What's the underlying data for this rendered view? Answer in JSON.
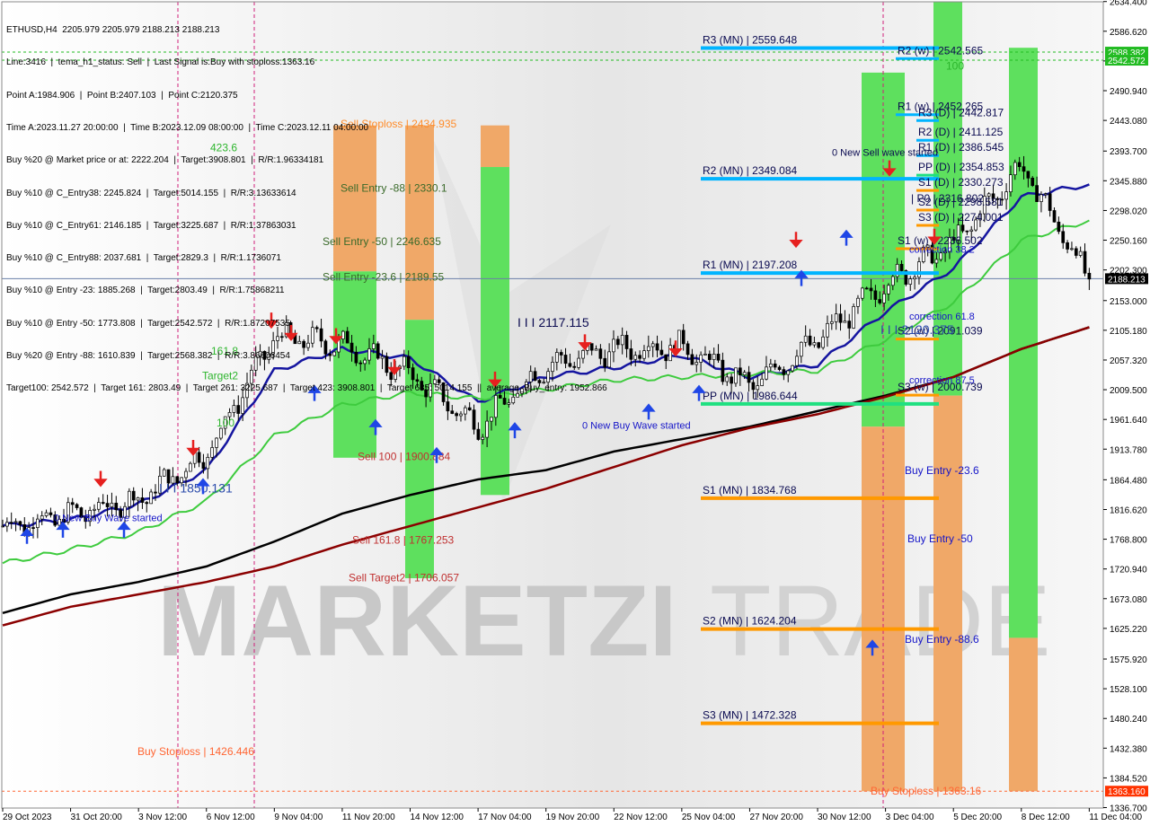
{
  "info_panel": [
    "ETHUSD,H4  2205.979 2205.979 2188.213 2188.213",
    "Line:3416  |  tema_h1_status: Sell  |  Last Signal is:Buy with stoploss:1363.16",
    "Point A:1984.906  |  Point B:2407.103  |  Point C:2120.375",
    "Time A:2023.11.27 20:00:00  |  Time B:2023.12.09 08:00:00  |  Time C:2023.12.11 04:00:00",
    "Buy %20 @ Market price or at: 2222.204  |  Target:3908.801  |  R/R:1.96334181",
    "Buy %10 @ C_Entry38: 2245.824  |  Target:5014.155  |  R/R:3.13633614",
    "Buy %10 @ C_Entry61: 2146.185  |  Target:3225.687  |  R/R:1.37863031",
    "Buy %10 @ C_Entry88: 2037.681  |  Target:2829.3  |  R/R:1.1736071",
    "Buy %10 @ Entry -23: 1885.268  |  Target:2803.49  |  R/R:1.75868211",
    "Buy %10 @ Entry -50: 1773.808  |  Target:2542.572  |  R/R:1.87207535",
    "Buy %20 @ Entry -88: 1610.839  |  Target:2568.382  |  R/R:3.86606454",
    "Target100: 2542.572  |  Target 161: 2803.49  |  Target 261: 3225.687  |  Target 423: 3908.801  |  Target 685: 5014.155  ||  average_Buy_entry: 1952.866"
  ],
  "chart_data": {
    "type": "candlestick",
    "symbol": "ETHUSD",
    "timeframe": "H4",
    "ohlc": {
      "open": 2205.979,
      "high": 2205.979,
      "low": 2188.213,
      "close": 2188.213
    },
    "current_price": 2188.213,
    "ylim": [
      1336.0,
      2634.0
    ],
    "y_ticks": [
      2634.4,
      2586.6,
      2538.8,
      2490.9,
      2443.0,
      2393.7,
      2345.9,
      2298.0,
      2250.2,
      2202.3,
      2153.0,
      2105.2,
      2057.3,
      2009.5,
      1961.6,
      1913.8,
      1864.5,
      1816.6,
      1768.8,
      1720.9,
      1673.1,
      1625.2,
      1575.9,
      1528.1,
      1480.2,
      1432.4,
      1384.5,
      1336.7
    ],
    "y_tick_labels": [
      "2634.400",
      "2586.620",
      "2538.800",
      "2490.940",
      "2443.080",
      "2393.700",
      "2345.880",
      "2298.020",
      "2250.160",
      "2202.300",
      "2153.000",
      "2105.180",
      "2057.320",
      "2009.500",
      "1961.640",
      "1913.780",
      "1864.480",
      "1816.620",
      "1768.800",
      "1720.940",
      "1673.080",
      "1625.220",
      "1575.920",
      "1528.100",
      "1480.240",
      "1432.380",
      "1384.520",
      "1336.700"
    ],
    "x_ticks": [
      "29 Oct 2023",
      "31 Oct 20:00",
      "3 Nov 12:00",
      "6 Nov 12:00",
      "9 Nov 04:00",
      "11 Nov 20:00",
      "14 Nov 12:00",
      "17 Nov 04:00",
      "19 Nov 20:00",
      "22 Nov 12:00",
      "25 Nov 04:00",
      "27 Nov 20:00",
      "30 Nov 12:00",
      "3 Dec 04:00",
      "5 Dec 20:00",
      "8 Dec 12:00",
      "11 Dec 04:00"
    ],
    "price_markers": [
      {
        "label": "2588.382",
        "value": 2553,
        "color": "#22bb22"
      },
      {
        "label": "2542.572",
        "value": 2540,
        "color": "#22bb22"
      },
      {
        "label": "2188.213",
        "value": 2188.213,
        "color": "#000000"
      },
      {
        "label": "1363.160",
        "value": 1363.16,
        "color": "#ff3300"
      }
    ],
    "trend_points": [
      [
        "29 Oct 2023",
        1790
      ],
      [
        "31 Oct 20:00",
        1808
      ],
      [
        "3 Nov 12:00",
        1832
      ],
      [
        "6 Nov 12:00",
        1905
      ],
      [
        "9 Nov 04:00",
        2095
      ],
      [
        "11 Nov 20:00",
        2082
      ],
      [
        "14 Nov 12:00",
        2035
      ],
      [
        "17 Nov 04:00",
        1950
      ],
      [
        "19 Nov 20:00",
        2048
      ],
      [
        "22 Nov 12:00",
        2075
      ],
      [
        "25 Nov 04:00",
        2080
      ],
      [
        "27 Nov 20:00",
        2015
      ],
      [
        "30 Nov 12:00",
        2090
      ],
      [
        "3 Dec 04:00",
        2180
      ],
      [
        "5 Dec 20:00",
        2245
      ],
      [
        "8 Dec 12:00",
        2370
      ],
      [
        "11 Dec 04:00",
        2188
      ]
    ],
    "series": [
      {
        "name": "",
        "color": "#1515a0",
        "values": [
          1790,
          1800,
          1825,
          1880,
          2040,
          2075,
          2060,
          1990,
          2030,
          2045,
          2065,
          2030,
          2050,
          2135,
          2205,
          2320,
          2340
        ]
      },
      {
        "name": "",
        "color": "#3ecb3e",
        "values": [
          1730,
          1752,
          1780,
          1830,
          1935,
          1985,
          2005,
          1995,
          2010,
          2025,
          2030,
          2035,
          2040,
          2090,
          2150,
          2250,
          2282
        ]
      },
      {
        "name": "",
        "color": "#000000",
        "values": [
          1650,
          1680,
          1700,
          1725,
          1765,
          1810,
          1840,
          1865,
          1880,
          1910,
          1930,
          1950,
          1975,
          2000,
          2030,
          2075,
          2110
        ]
      },
      {
        "name": "",
        "color": "#8b0000",
        "values": [
          1630,
          1660,
          1680,
          1700,
          1725,
          1760,
          1790,
          1820,
          1850,
          1885,
          1920,
          1948,
          1970,
          1998,
          2030,
          2075,
          2110
        ]
      }
    ],
    "levels": [
      {
        "label": "R3 (MN) | 2559.648",
        "value": 2559.648,
        "color": "#00b4ff"
      },
      {
        "label": "R2 (MN) | 2349.084",
        "value": 2349.084,
        "color": "#00b4ff"
      },
      {
        "label": "R1 (MN) | 2197.208",
        "value": 2197.208,
        "color": "#00b4ff"
      },
      {
        "label": "PP (MN) | 1986.644",
        "value": 1986.644,
        "color": "#1fe080"
      },
      {
        "label": "S1 (MN) | 1834.768",
        "value": 1834.768,
        "color": "#ff9900"
      },
      {
        "label": "S2 (MN) | 1624.204",
        "value": 1624.204,
        "color": "#ff9900"
      },
      {
        "label": "S3 (MN) | 1472.328",
        "value": 1472.328,
        "color": "#ff9900"
      },
      {
        "label": "R2 (w) | 2542.565",
        "value": 2542.565,
        "color": "#00b4ff"
      },
      {
        "label": "R1 (w) | 2452.265",
        "value": 2452.265,
        "color": "#00b4ff"
      },
      {
        "label": "S1 (w) | 2236.502",
        "value": 2236.502,
        "color": "#ff9900"
      },
      {
        "label": "S2 (w) | 2091.039",
        "value": 2091.039,
        "color": "#ff9900"
      },
      {
        "label": "S3 (w) | 2000.739",
        "value": 2000.739,
        "color": "#ff9900"
      },
      {
        "label": "R3 (D) | 2442.817",
        "value": 2442.817,
        "color": "#00b4ff"
      },
      {
        "label": "R2 (D) | 2411.125",
        "value": 2411.125,
        "color": "#00b4ff"
      },
      {
        "label": "R1 (D) | 2386.545",
        "value": 2386.545,
        "color": "#00b4ff"
      },
      {
        "label": "PP (D) | 2354.853",
        "value": 2354.853,
        "color": "#1fe080"
      },
      {
        "label": "S1 (D) | 2330.273",
        "value": 2330.273,
        "color": "#ff9900"
      },
      {
        "label": "S2 (D) | 2298.581",
        "value": 2298.581,
        "color": "#ff9900"
      },
      {
        "label": "S3 (D) | 2274.001",
        "value": 2274.001,
        "color": "#ff9900"
      }
    ],
    "annotations": [
      "Sell Stoploss | 2434.935",
      "Sell Entry -88 | 2330.1",
      "Sell Entry -50 | 2246.635",
      "Sell Entry -23.6 | 2189.55",
      "Sell 100 | 1900.884",
      "Sell 161.8 | 1767.253",
      "Sell Target2 | 1706.057",
      "Buy Stoploss | 1426.446",
      "Buy Stoploss | 1363.16",
      "I I I 2117.115",
      "I I I 1850.131",
      "I I I 2120.375",
      "0 New Buy Wave started",
      "0 New Buy Wave started",
      "0 New Sell wave started",
      "Buy Entry -23.6",
      "Buy Entry -50",
      "Buy Entry -88.6",
      "correction 38.2",
      "correction 61.8",
      "correction 87.5",
      "| P0 | 2316.802",
      "423.6",
      "161.8",
      "Target2",
      "100",
      "100"
    ],
    "watermark": "MARKETZITRADE"
  }
}
